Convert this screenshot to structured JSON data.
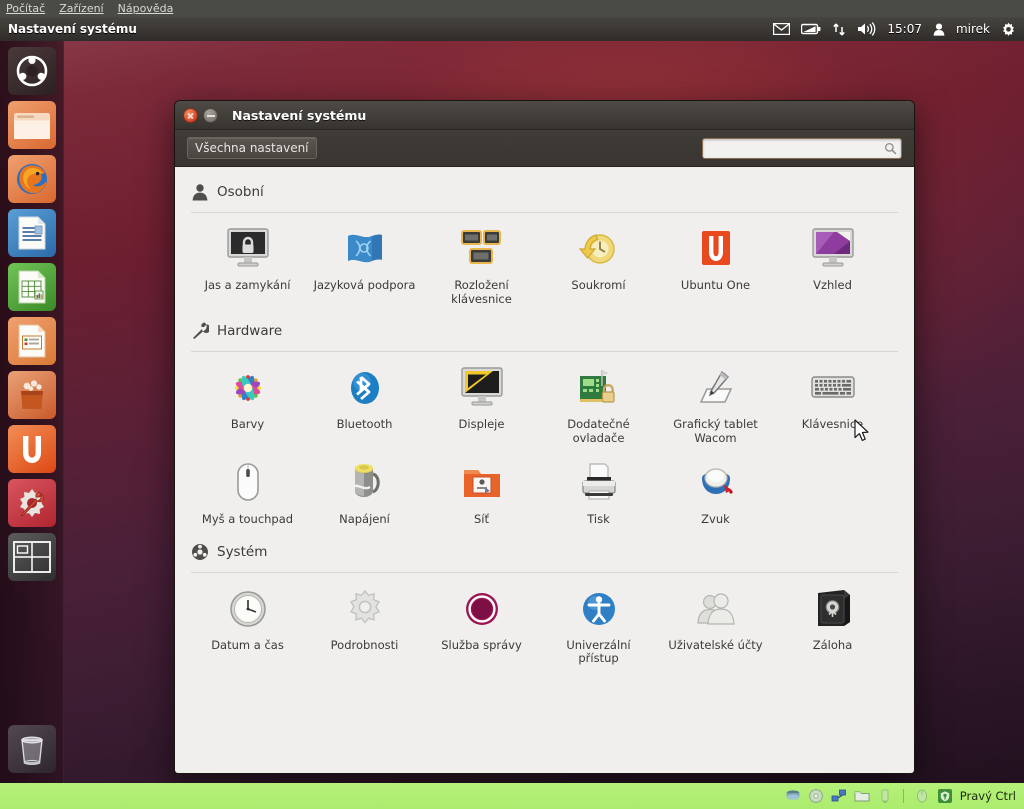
{
  "vbox": {
    "menus": [
      {
        "label": "Počítač",
        "accel": "P"
      },
      {
        "label": "Zařízení",
        "accel": "Z"
      },
      {
        "label": "Nápověda",
        "accel": "N"
      }
    ],
    "status": {
      "host_key": "Pravý Ctrl",
      "icons": [
        "harddisk-icon",
        "cd-icon",
        "network-icon",
        "folder-icon",
        "usb-icon",
        "mouse-icon",
        "hostkey-icon"
      ]
    }
  },
  "panel": {
    "title": "Nastavení systému",
    "clock": "15:07",
    "user": "mirek",
    "indicators": [
      "mail-icon",
      "battery-icon",
      "network-updown-icon",
      "volume-icon"
    ],
    "session_icon": "gear-icon"
  },
  "launcher": {
    "items": [
      {
        "name": "dash-home",
        "label": "Dash",
        "running": false
      },
      {
        "name": "files",
        "label": "Souborový manažer",
        "running": false
      },
      {
        "name": "firefox",
        "label": "Firefox",
        "running": false
      },
      {
        "name": "libreoffice-writer",
        "label": "LibreOffice Writer",
        "running": false
      },
      {
        "name": "libreoffice-calc",
        "label": "LibreOffice Calc",
        "running": false
      },
      {
        "name": "libreoffice-impress",
        "label": "LibreOffice Impress",
        "running": false
      },
      {
        "name": "software-center",
        "label": "Centrum softwaru",
        "running": false
      },
      {
        "name": "ubuntu-one",
        "label": "Ubuntu One",
        "running": false
      },
      {
        "name": "system-settings",
        "label": "Nastavení systému",
        "running": true
      },
      {
        "name": "workspace-switcher",
        "label": "Přepínač ploch",
        "running": false
      }
    ],
    "trash": {
      "name": "trash",
      "label": "Koš"
    }
  },
  "window": {
    "title": "Nastavení systému",
    "all_settings_label": "Všechna nastavení",
    "search": {
      "value": "",
      "placeholder": ""
    },
    "sections": [
      {
        "id": "personal",
        "label": "Osobní",
        "icon": "person-icon",
        "items": [
          {
            "label": "Jas a zamykání",
            "icon": "brightness-lock-icon"
          },
          {
            "label": "Jazyková podpora",
            "icon": "language-icon"
          },
          {
            "label": "Rozložení klávesnice",
            "icon": "keyboard-layout-icon"
          },
          {
            "label": "Soukromí",
            "icon": "privacy-icon"
          },
          {
            "label": "Ubuntu One",
            "icon": "ubuntu-one-icon"
          },
          {
            "label": "Vzhled",
            "icon": "appearance-icon"
          }
        ]
      },
      {
        "id": "hardware",
        "label": "Hardware",
        "icon": "wrench-icon",
        "items": [
          {
            "label": "Barvy",
            "icon": "color-icon"
          },
          {
            "label": "Bluetooth",
            "icon": "bluetooth-icon"
          },
          {
            "label": "Displeje",
            "icon": "displays-icon"
          },
          {
            "label": "Dodatečné ovladače",
            "icon": "drivers-icon"
          },
          {
            "label": "Grafický tablet Wacom",
            "icon": "wacom-icon"
          },
          {
            "label": "Klávesnice",
            "icon": "keyboard-icon"
          },
          {
            "label": "Myš a touchpad",
            "icon": "mouse-icon"
          },
          {
            "label": "Napájení",
            "icon": "power-icon"
          },
          {
            "label": "Síť",
            "icon": "network-icon"
          },
          {
            "label": "Tisk",
            "icon": "printer-icon"
          },
          {
            "label": "Zvuk",
            "icon": "sound-icon"
          }
        ]
      },
      {
        "id": "system",
        "label": "Systém",
        "icon": "ubuntu-system-icon",
        "items": [
          {
            "label": "Datum a čas",
            "icon": "clock-icon"
          },
          {
            "label": "Podrobnosti",
            "icon": "details-gear-icon"
          },
          {
            "label": "Služba správy",
            "icon": "landscape-icon"
          },
          {
            "label": "Univerzální přístup",
            "icon": "accessibility-icon"
          },
          {
            "label": "Uživatelské účty",
            "icon": "users-icon"
          },
          {
            "label": "Záloha",
            "icon": "backup-safe-icon"
          }
        ]
      }
    ]
  },
  "colors": {
    "ubuntu_orange": "#dd4814",
    "panel_bg": "#3c3834",
    "window_bg": "#f0efee",
    "vbox_status_green": "#abec6d"
  }
}
